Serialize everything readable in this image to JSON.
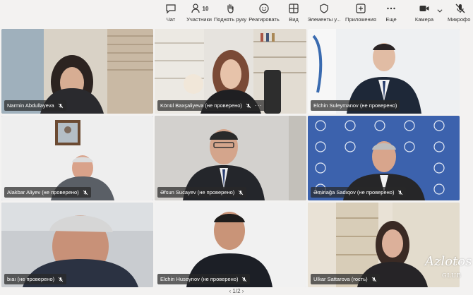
{
  "toolbar": {
    "chat_label": "Чат",
    "participants_label": "Участники",
    "participants_count": "10",
    "raise_hand_label": "Поднять руку",
    "react_label": "Реагировать",
    "view_label": "Вид",
    "elements_label": "Элементы у...",
    "apps_label": "Приложения",
    "more_label": "Еще",
    "camera_label": "Камера",
    "mic_label": "Микрофо"
  },
  "participants": [
    {
      "name": "Narmin Abdullayeva",
      "more": ""
    },
    {
      "name": "Könül Baxşaliyeva (не проверено)",
      "more": "···"
    },
    {
      "name": "Elchin Suleymanov (не проверено)",
      "more": ""
    },
    {
      "name": "Alakbar Aliyev (не проверено)",
      "more": ""
    },
    {
      "name": "Əfsun Sucayev (не проверено)",
      "more": ""
    },
    {
      "name": "Əminağa Sadıqov (не проверено)",
      "more": ""
    },
    {
      "name": "bıaı (не проверено)",
      "more": ""
    },
    {
      "name": "Elchin Huseynov (не проверено)",
      "more": ""
    },
    {
      "name": "Ulkar Sattarova (гость)",
      "more": ""
    }
  ],
  "pager": {
    "label": "‹ 1/2 ›"
  },
  "watermark": {
    "main": "Azlotos",
    "sub": "GLUB"
  },
  "colors": {
    "active_outline": "#6f78c8",
    "toolbar_bg": "#f3f2f1"
  }
}
